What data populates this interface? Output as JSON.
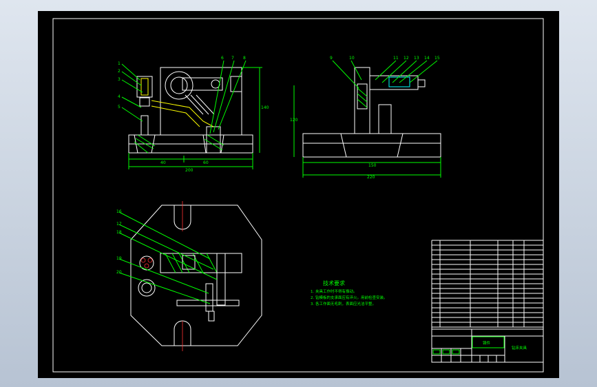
{
  "drawing": {
    "technical_requirements": {
      "title": "技术要求",
      "items": [
        "1. 夹具工作时不得有振动。",
        "2. 钻模板的支承面应有淬火。用前检查安装。",
        "3. 各工作面无毛刺，表面应光洁平整。"
      ]
    },
    "title_block": {
      "drawing_name": "钻床夹具",
      "stamp": "铸件"
    },
    "dimensions": {
      "front_width": "200",
      "front_left": "40",
      "front_right": "60",
      "front_height": "140",
      "side_width": "220",
      "side_inner": "150",
      "side_height": "120"
    },
    "part_labels_front": [
      "1",
      "2",
      "3",
      "4",
      "5",
      "6",
      "7",
      "8"
    ],
    "part_labels_side": [
      "9",
      "10",
      "11",
      "12",
      "13",
      "14",
      "15"
    ],
    "part_labels_plan": [
      "16",
      "17",
      "18",
      "19",
      "20"
    ],
    "bom_rows": 18
  }
}
